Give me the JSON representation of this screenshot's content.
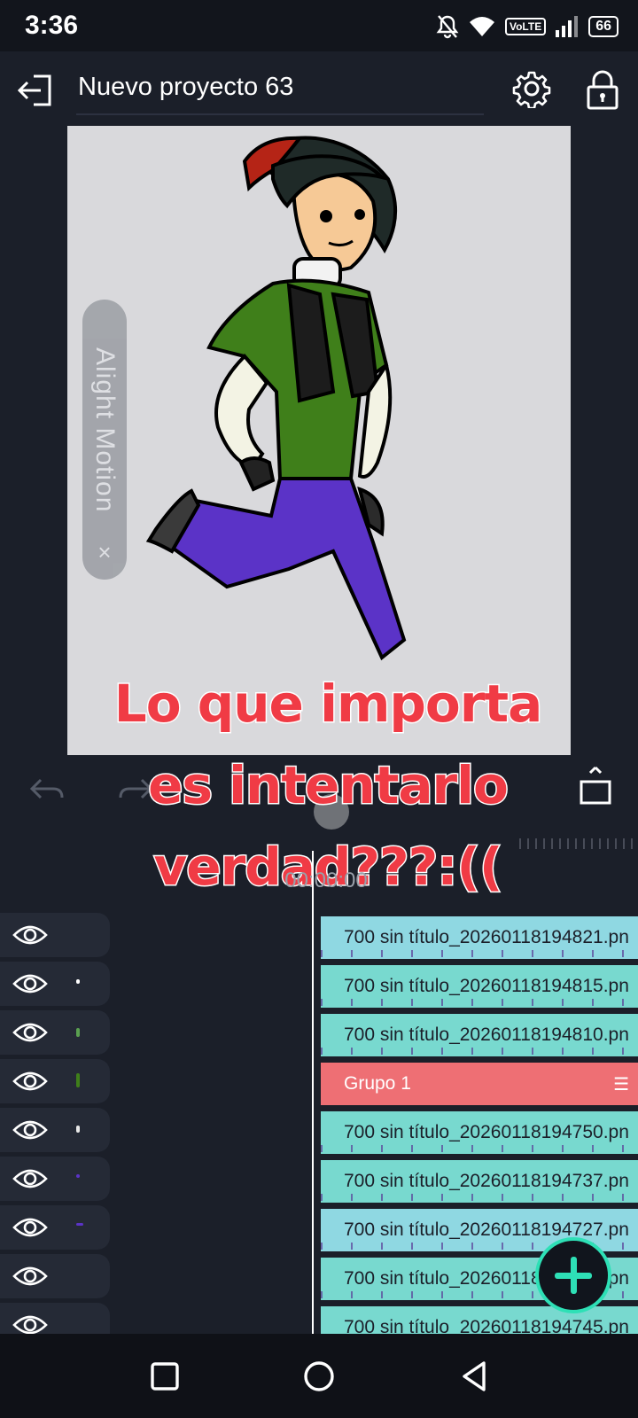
{
  "status_bar": {
    "time": "3:36",
    "network": "VoLTE",
    "battery": "66"
  },
  "header": {
    "title": "Nuevo proyecto 63"
  },
  "watermark": {
    "text": "Alight Motion",
    "close": "×"
  },
  "caption": {
    "lines": [
      "Lo que importa",
      "es intentarlo",
      "verdad???:(("
    ]
  },
  "timeline": {
    "timecode": "00:00:00",
    "tracks": [
      {
        "label": "700 sin título_20260118194821.pn",
        "type": "image"
      },
      {
        "label": "700 sin título_20260118194815.pn",
        "type": "image"
      },
      {
        "label": "700 sin título_20260118194810.pn",
        "type": "image"
      },
      {
        "label": "Grupo 1",
        "type": "group"
      },
      {
        "label": "700 sin título_20260118194750.pn",
        "type": "image"
      },
      {
        "label": "700 sin título_20260118194737.pn",
        "type": "image"
      },
      {
        "label": "700 sin título_20260118194727.pn",
        "type": "image"
      },
      {
        "label": "700 sin título_20260118194725.pn",
        "type": "image"
      },
      {
        "label": "700 sin título_20260118194745.pn",
        "type": "image"
      }
    ]
  },
  "colors": {
    "accent": "#2ee0b6",
    "caption": "#f03b45",
    "group_track": "#ee6f74",
    "track_a": "#8fd8e2",
    "track_b": "#78d9cf"
  },
  "icons": {
    "back": "exit-icon",
    "settings": "gear-icon",
    "lock": "lock-icon",
    "undo": "undo-icon",
    "redo": "redo-icon",
    "fullscreen": "fullscreen-icon",
    "add": "plus-icon",
    "visibility": "eye-icon"
  }
}
